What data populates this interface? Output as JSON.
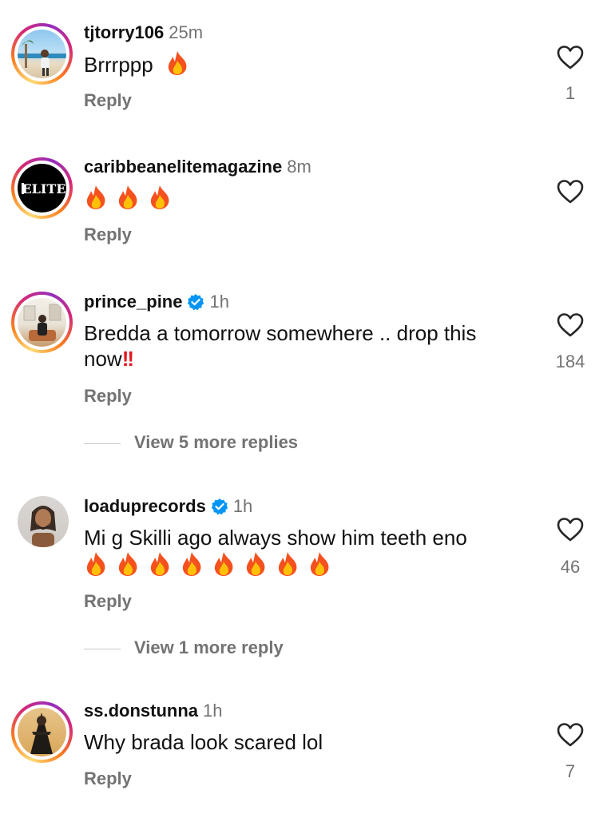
{
  "comments": [
    {
      "username": "tjtorry106",
      "time": "25m",
      "text": "Brrrppp",
      "fires": 1,
      "likes": "1",
      "reply": "Reply"
    },
    {
      "username": "caribbeanelitemagazine",
      "time": "8m",
      "text": "",
      "fires": 3,
      "likes": "",
      "reply": "Reply",
      "avatar_text": "ELITE"
    },
    {
      "username": "prince_pine",
      "verified": true,
      "time": "1h",
      "text_line1": "Bredda a tomorrow somewhere .. drop this",
      "text_line2": "now",
      "likes": "184",
      "reply": "Reply",
      "view_replies": "View 5 more replies"
    },
    {
      "username": "loaduprecords",
      "verified": true,
      "time": "1h",
      "text": "Mi g Skilli ago always show him teeth eno",
      "fires": 8,
      "likes": "46",
      "reply": "Reply",
      "view_replies": "View 1 more reply"
    },
    {
      "username": "ss.donstunna",
      "time": "1h",
      "text": "Why brada look scared lol",
      "likes": "7",
      "reply": "Reply"
    }
  ],
  "colors": {
    "accent_verified": "#0095f6",
    "secondary_text": "#737373",
    "fire": "#f4511e"
  },
  "icons": {
    "like": "heart-outline-icon",
    "verified": "verified-badge-icon",
    "fire": "fire-emoji-icon",
    "double_exclamation": "double-exclamation-emoji"
  }
}
